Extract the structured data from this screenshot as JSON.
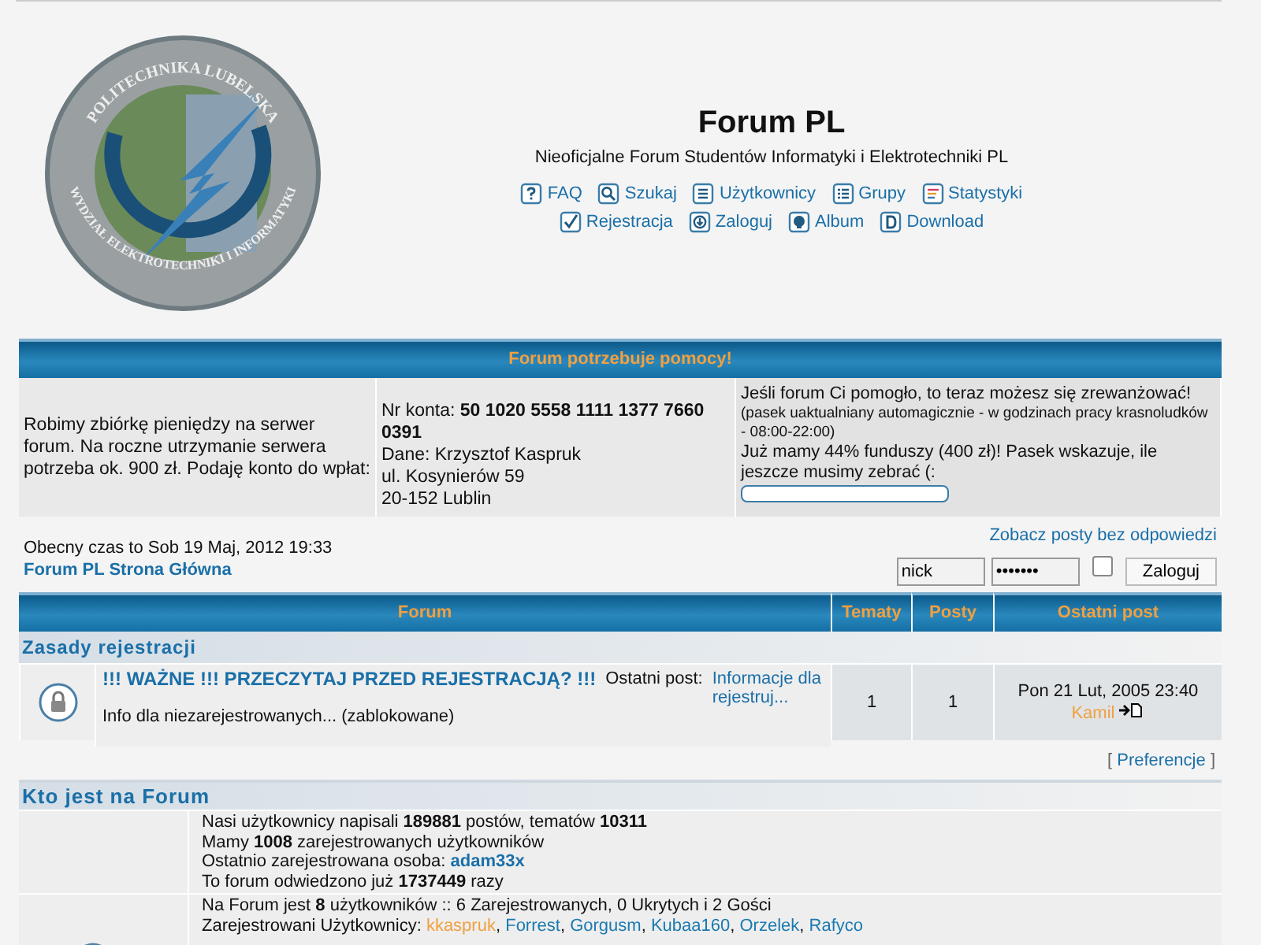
{
  "logo": {
    "top_text": "POLITECHNIKA LUBELSKA",
    "bottom_text": "WYDZIAŁ ELEKTROTECHNIKI I INFORMATYKI"
  },
  "header": {
    "title": "Forum PL",
    "subtitle": "Nieoficjalne Forum Studentów Informatyki i Elektrotechniki PL",
    "nav_rows": [
      [
        {
          "kind": "faq",
          "label": "FAQ"
        },
        {
          "kind": "search",
          "label": "Szukaj"
        },
        {
          "kind": "list",
          "label": "Użytkownicy"
        },
        {
          "kind": "groups",
          "label": "Grupy"
        },
        {
          "kind": "stats",
          "label": "Statystyki"
        }
      ],
      [
        {
          "kind": "register",
          "label": "Rejestracja"
        },
        {
          "kind": "login",
          "label": "Zaloguj"
        },
        {
          "kind": "album",
          "label": "Album"
        },
        {
          "kind": "download",
          "label": "Download"
        }
      ]
    ]
  },
  "donation": {
    "heading": "Forum potrzebuje pomocy!",
    "appeal": "Robimy zbiórkę pieniędzy na serwer forum. Na roczne utrzymanie serwera potrzeba ok. 900 zł. Podaję konto do wpłat:",
    "account": "Nr konta: **50 1020 5558 1111 1377 7660 0391**",
    "address_lines": [
      "Dane: Krzysztof Kaspruk",
      "ul. Kosynierów 59",
      "20-152 Lublin"
    ],
    "thanks": "Jeśli forum Ci pomogło, to teraz możesz się zrewanżować!",
    "note": "(pasek uaktualniany automagicznie - w godzinach pracy krasnoludków - 08:00-22:00)",
    "progress_text": "Już mamy 44% funduszy (400 zł)! Pasek wskazuje, ile jeszcze musimy zebrać (:",
    "level": 0
  },
  "info": {
    "current_time": "Obecny czas to Sob 19 Maj, 2012 19:33",
    "home_link": "Forum PL Strona Główna",
    "unanswered_link": "Zobacz posty bez odpowiedzi",
    "login": {
      "username": "nick",
      "password": "•••••••",
      "remember": false,
      "button": "Zaloguj"
    }
  },
  "forum_table": {
    "columns": [
      "Forum",
      "Tematy",
      "Posty",
      "Ostatni post"
    ],
    "categories": [
      {
        "name": "Zasady rejestracji",
        "forums": [
          {
            "locked": true,
            "title": "!!! WAŻNE !!! PRZECZYTAJ PRZED REJESTRACJĄ? !!!",
            "last_post_label": "Ostatni post:",
            "last_post_link": "Informacje dla rejestruj...",
            "description": "Info dla niezarejestrowanych... (zablokowane)",
            "topics": "1",
            "posts": "1",
            "last_date": "Pon 21 Lut, 2005 23:40",
            "last_author": "Kamil"
          }
        ]
      }
    ]
  },
  "preferences": {
    "open": "[",
    "label": "Preferencje",
    "close": "]"
  },
  "who_is_online": {
    "heading": "Kto jest na Forum",
    "stats": [
      {
        "text": "Nasi użytkownicy napisali **189881** postów, tematów **10311**"
      },
      {
        "text": "Mamy **1008** zarejestrowanych użytkowników"
      },
      {
        "text": "Ostatnio zarejestrowana osoba:",
        "link": "adam33x"
      },
      {
        "text": "To forum odwiedzono już **1737449** razy"
      }
    ],
    "online_summary": "Na Forum jest **8** użytkowników :: 6 Zarejestrowanych, 0 Ukrytych i 2 Gości",
    "registered_label": "Zarejestrowani Użytkownicy:",
    "separator": ",",
    "users": [
      {
        "name": "kkaspruk",
        "color": "#f0a040"
      },
      {
        "name": "Forrest",
        "color": "#1a7ab0"
      },
      {
        "name": "Gorgusm",
        "color": "#1a7ab0"
      },
      {
        "name": "Kubaa160",
        "color": "#1a7ab0"
      },
      {
        "name": "Orzelek",
        "color": "#1a7ab0"
      },
      {
        "name": "Rafyco",
        "color": "#1a7ab0"
      }
    ]
  }
}
